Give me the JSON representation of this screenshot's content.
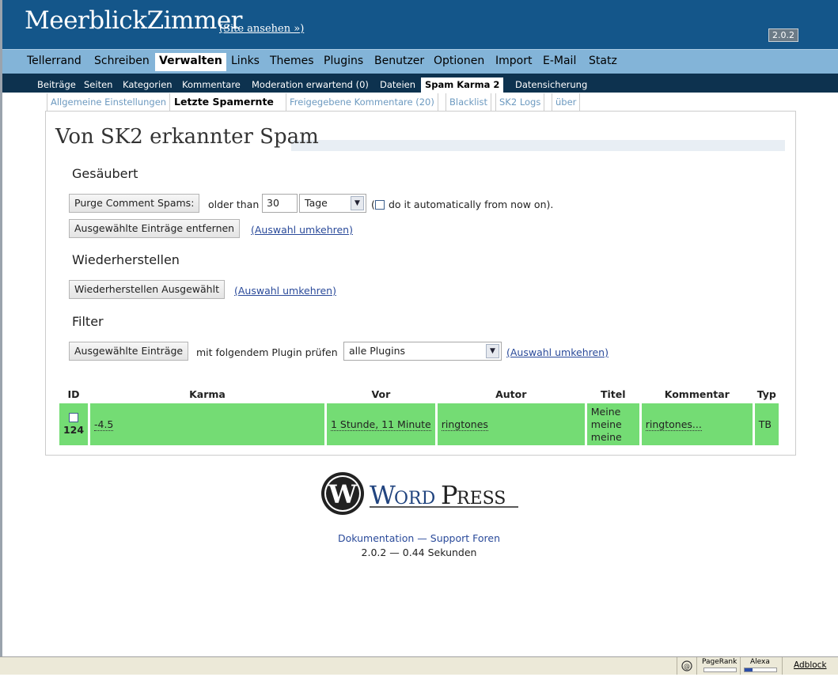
{
  "header": {
    "blog_title": "MeerblickZimmer",
    "view_site": "(Site ansehen »)",
    "version": "2.0.2"
  },
  "mainnav": [
    "Tellerrand",
    "Schreiben",
    "Verwalten",
    "Links",
    "Themes",
    "Plugins",
    "Benutzer",
    "Optionen",
    "Import",
    "E-Mail",
    "Statz"
  ],
  "mainnav_active": "Verwalten",
  "subnav": [
    "Beiträge",
    "Seiten",
    "Kategorien",
    "Kommentare",
    "Moderation erwartend (0)",
    "Dateien",
    "Spam Karma 2",
    "Datensicherung"
  ],
  "subnav_active": "Spam Karma 2",
  "tabs": [
    "Allgemeine Einstellungen",
    "Letzte Spamernte",
    "Freigegebene Kommentare (20)",
    "Blacklist",
    "SK2 Logs",
    "über"
  ],
  "tabs_active": "Letzte Spamernte",
  "page": {
    "title": "Von SK2 erkannter Spam",
    "purged": {
      "heading": "Gesäubert",
      "purge_button": "Purge Comment Spams:",
      "older_than": "older than",
      "days_value": "30",
      "unit_select": "Tage",
      "auto_prefix": "(",
      "auto_label": "do it automatically from now on).",
      "remove_button": "Ausgewählte Einträge entfernen",
      "invert_link": "(Auswahl umkehren)"
    },
    "restore": {
      "heading": "Wiederherstellen",
      "restore_button": "Wiederherstellen Ausgewählt",
      "invert_link": "(Auswahl umkehren)"
    },
    "filter": {
      "heading": "Filter",
      "check_button": "Ausgewählte Einträge",
      "check_text": "mit folgendem Plugin prüfen",
      "plugin_select": "alle Plugins",
      "invert_link": "(Auswahl umkehren)"
    },
    "table": {
      "headers": [
        "ID",
        "Karma",
        "Vor",
        "Autor",
        "Titel",
        "Kommentar",
        "Typ"
      ],
      "rows": [
        {
          "id": "124",
          "karma": "-4.5",
          "ago": "1 Stunde, 11 Minute",
          "author": "ringtones",
          "title": "Meine meine meine",
          "comment": "ringtones...",
          "type": "TB"
        }
      ]
    }
  },
  "footer": {
    "logo_word": "WordPress",
    "links": "Dokumentation — Support Foren",
    "version_time": "2.0.2 — 0.44 Sekunden"
  },
  "statusbar": {
    "pagerank": "PageRank",
    "alexa": "Alexa",
    "adblock": "Adblock"
  },
  "colors": {
    "header_bg": "#14568a",
    "mainnav_bg": "#83b4d8",
    "subnav_bg": "#0d324f",
    "spam_row": "#74dc74",
    "link": "#2a4a9a"
  }
}
